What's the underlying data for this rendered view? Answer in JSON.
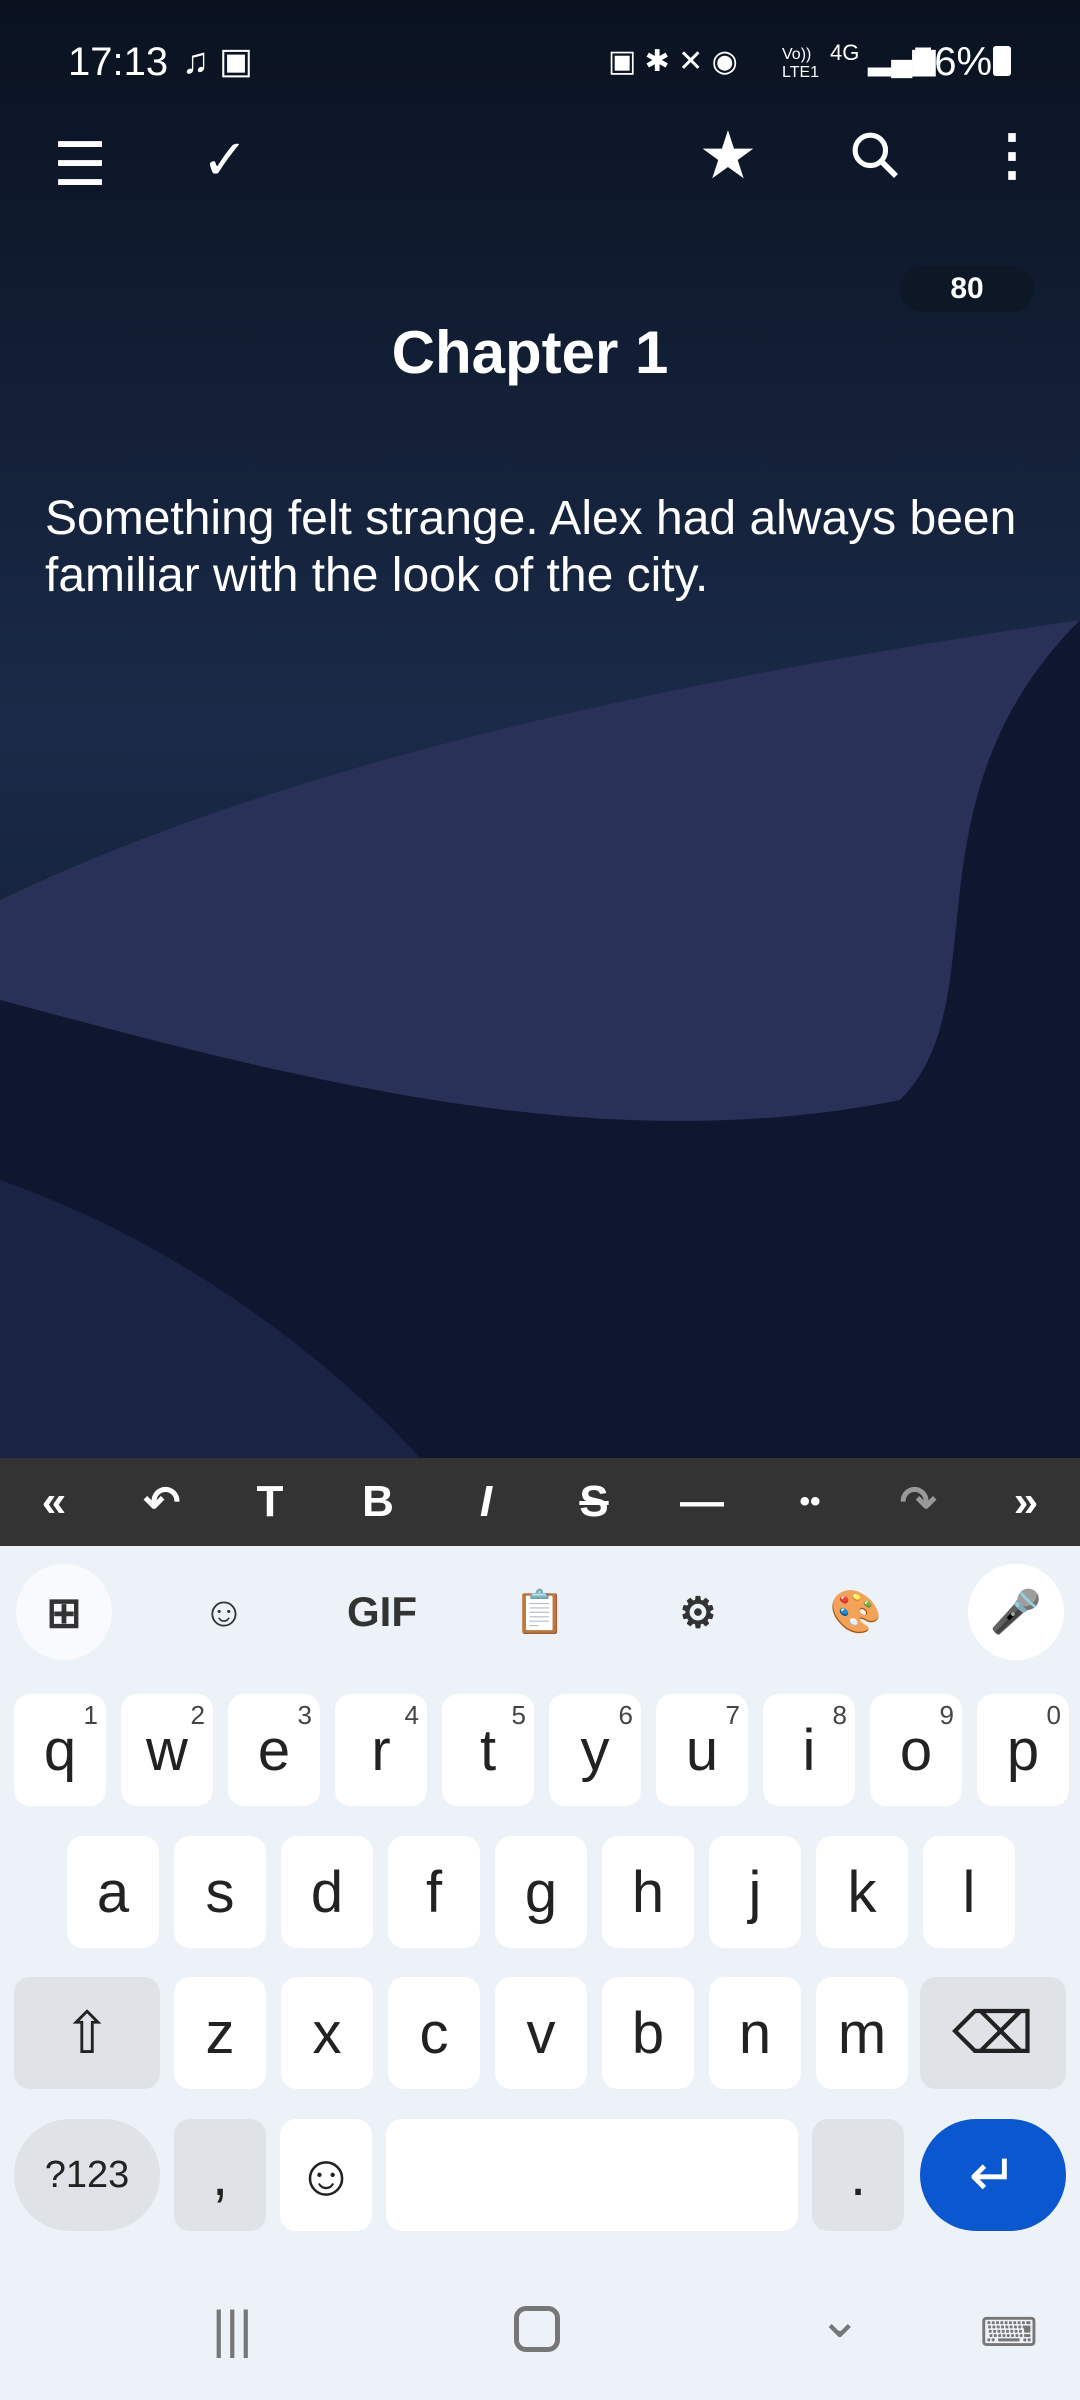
{
  "status_bar": {
    "time": "17:13",
    "battery": "56%",
    "network": "4G",
    "volte": "Vo)) LTE1"
  },
  "app_bar": {
    "icons": [
      "menu-icon",
      "check-icon",
      "star-icon",
      "search-icon",
      "more-vert-icon"
    ]
  },
  "word_count": "80",
  "document": {
    "title": "Chapter 1",
    "body": "Something felt strange. Alex had always been familiar with the look of the city."
  },
  "format_toolbar": {
    "items": [
      "«",
      "↶",
      "T",
      "B",
      "I",
      "S",
      "—",
      "••",
      "↷",
      "»"
    ]
  },
  "keyboard": {
    "tools": {
      "gif": "GIF"
    },
    "row1": [
      [
        "q",
        "1"
      ],
      [
        "w",
        "2"
      ],
      [
        "e",
        "3"
      ],
      [
        "r",
        "4"
      ],
      [
        "t",
        "5"
      ],
      [
        "y",
        "6"
      ],
      [
        "u",
        "7"
      ],
      [
        "i",
        "8"
      ],
      [
        "o",
        "9"
      ],
      [
        "p",
        "0"
      ]
    ],
    "row2": [
      "a",
      "s",
      "d",
      "f",
      "g",
      "h",
      "j",
      "k",
      "l"
    ],
    "row3": [
      "z",
      "x",
      "c",
      "v",
      "b",
      "n",
      "m"
    ],
    "symbols": "?123",
    "comma": ",",
    "period": ".",
    "enter_color": "#0b57d0"
  }
}
